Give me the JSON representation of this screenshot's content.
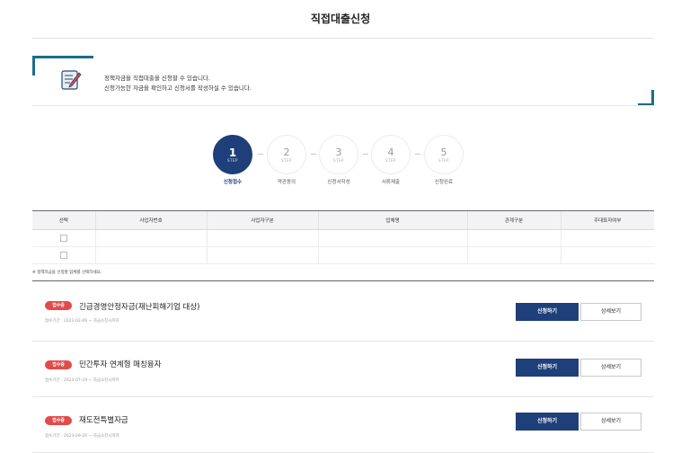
{
  "page": {
    "title": "직접대출신청"
  },
  "notice": {
    "icon": "form-write-icon",
    "line1": "정책자금을 직접대출을 신청할 수 있습니다.",
    "line2": "신청가능한 자금을 확인하고 신청서를 작성하실 수 있습니다."
  },
  "steps": [
    {
      "number": "1",
      "step_text": "STEP",
      "label": "신청접수",
      "active": true
    },
    {
      "number": "2",
      "step_text": "STEP",
      "label": "약관동의",
      "active": false
    },
    {
      "number": "3",
      "step_text": "STEP",
      "label": "신청서작성",
      "active": false
    },
    {
      "number": "4",
      "step_text": "STEP",
      "label": "서류제출",
      "active": false
    },
    {
      "number": "5",
      "step_text": "STEP",
      "label": "신청완료",
      "active": false
    }
  ],
  "table": {
    "headers": [
      "선택",
      "사업자번호",
      "사업자구분",
      "업체명",
      "관계구분",
      "주대표자여부"
    ],
    "rows": [
      [
        "",
        "",
        "",
        "",
        "",
        ""
      ],
      [
        "",
        "",
        "",
        "",
        "",
        ""
      ]
    ],
    "note": "※ 정책자금을 신청할 업체를 선택하세요."
  },
  "items": [
    {
      "badge": "접수중",
      "title": "긴급경영안정자금(재난피해기업 대상)",
      "period": "접수기간 : 2023-02-06 ~ 자금소진시까지",
      "apply_label": "신청하기",
      "detail_label": "상세보기"
    },
    {
      "badge": "접수중",
      "title": "민간투자 연계형 매칭융자",
      "period": "접수기간 : 2023-07-19 ~ 자금소진시까지",
      "apply_label": "신청하기",
      "detail_label": "상세보기"
    },
    {
      "badge": "접수중",
      "title": "재도전특별자금",
      "period": "접수기간 : 2023-09-20 ~ 자금소진시까지",
      "apply_label": "신청하기",
      "detail_label": "상세보기"
    }
  ],
  "colors": {
    "primary": "#1e3f7a",
    "badge": "#e34a4a",
    "accent": "#1c6c8c"
  }
}
